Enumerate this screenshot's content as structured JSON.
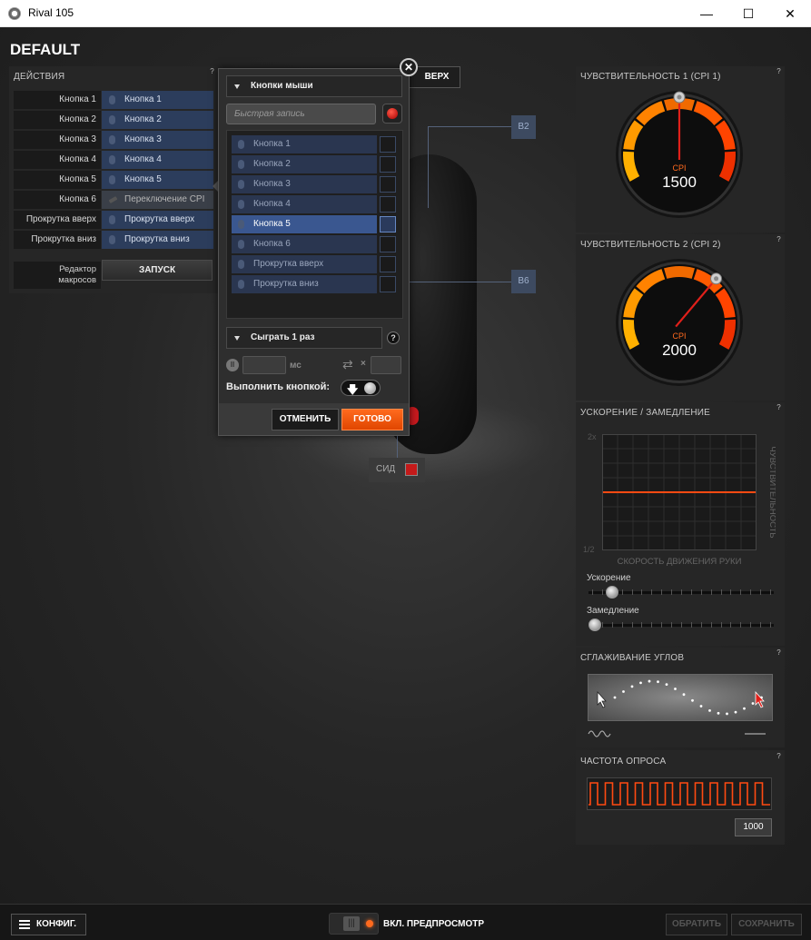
{
  "window": {
    "title": "Rival 105",
    "controls": {
      "minimize": "—",
      "maximize": "☐",
      "close": "✕"
    }
  },
  "profile": {
    "name": "DEFAULT"
  },
  "actions": {
    "title": "ДЕЙСТВИЯ",
    "help": "?",
    "rows": [
      {
        "label": "Кнопка 1",
        "value": "Кнопка 1"
      },
      {
        "label": "Кнопка 2",
        "value": "Кнопка 2"
      },
      {
        "label": "Кнопка 3",
        "value": "Кнопка 3"
      },
      {
        "label": "Кнопка 4",
        "value": "Кнопка 4"
      },
      {
        "label": "Кнопка 5",
        "value": "Кнопка 5"
      },
      {
        "label": "Кнопка 6",
        "value": "Переключение CPI"
      },
      {
        "label": "Прокрутка вверх",
        "value": "Прокрутка вверх"
      },
      {
        "label": "Прокрутка вниз",
        "value": "Прокрутка вниз"
      }
    ],
    "macro_editor_label_line1": "Редактор",
    "macro_editor_label_line2": "макросов",
    "launch_button": "ЗАПУСК"
  },
  "mouse_preview": {
    "top_button": "ВЕРХ",
    "callouts": [
      "B2",
      "B6"
    ],
    "led_label": "СИД",
    "led_color": "#c41a1a"
  },
  "popup": {
    "close": "✕",
    "category_dropdown": "Кнопки мыши",
    "quick_record_placeholder": "Быстрая запись",
    "items": [
      {
        "label": "Кнопка 1",
        "selected": false
      },
      {
        "label": "Кнопка 2",
        "selected": false
      },
      {
        "label": "Кнопка 3",
        "selected": false
      },
      {
        "label": "Кнопка 4",
        "selected": false
      },
      {
        "label": "Кнопка 5",
        "selected": true
      },
      {
        "label": "Кнопка 6",
        "selected": false
      },
      {
        "label": "Прокрутка вверх",
        "selected": false
      },
      {
        "label": "Прокрутка вниз",
        "selected": false
      }
    ],
    "play_dropdown": "Сыграть 1 раз",
    "help": "?",
    "delay_unit": "мс",
    "repeat_symbol": "×",
    "execute_label": "Выполнить кнопкой:",
    "cancel_button": "ОТМЕНИТЬ",
    "done_button": "ГОТОВО"
  },
  "sensitivity1": {
    "title": "ЧУВСТВИТЕЛЬНОСТЬ 1 (CPI 1)",
    "unit": "CPI",
    "value": "1500",
    "level": 0.5
  },
  "sensitivity2": {
    "title": "ЧУВСТВИТЕЛЬНОСТЬ 2 (CPI 2)",
    "unit": "CPI",
    "value": "2000",
    "level": 0.667
  },
  "acceleration": {
    "title": "УСКОРЕНИЕ / ЗАМЕДЛЕНИЕ",
    "y_top": "2x",
    "y_bottom": "1/2",
    "x_label": "СКОРОСТЬ ДВИЖЕНИЯ РУКИ",
    "y_label": "ЧУВСТВИТЕЛЬНОСТЬ",
    "accel_label": "Ускорение",
    "decel_label": "Замедление",
    "accel_level": 0.1,
    "decel_level": 0.0
  },
  "angle_snapping": {
    "title": "СГЛАЖИВАНИЕ УГЛОВ",
    "level": 0.0
  },
  "polling_rate": {
    "title": "ЧАСТОТА ОПРОСА",
    "value": "1000",
    "level": 1.0
  },
  "colors": {
    "accent": "#ff5a12",
    "selection": "#3a5790",
    "action_bg": "#2c3d5c"
  },
  "footer": {
    "config_button": "КОНФИГ.",
    "preview_label": "ВКЛ. ПРЕДПРОСМОТР",
    "revert_button": "ОБРАТИТЬ",
    "save_button": "СОХРАНИТЬ"
  }
}
